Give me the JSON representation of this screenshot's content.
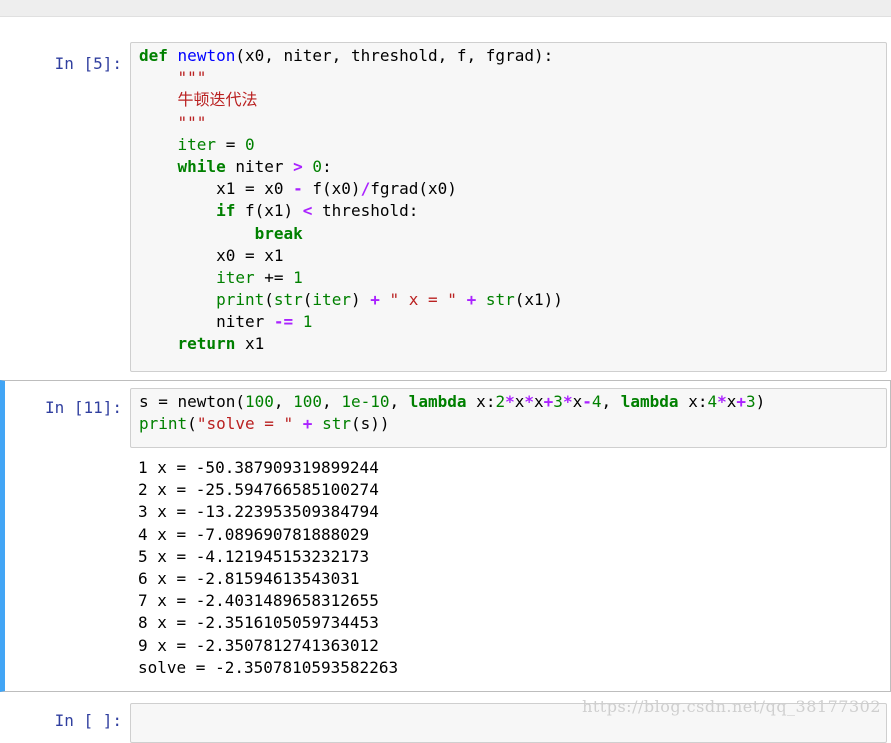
{
  "cells": [
    {
      "prompt": "In [5]:",
      "code_lines": [
        [
          {
            "t": "def",
            "c": "kw"
          },
          {
            "t": " "
          },
          {
            "t": "newton",
            "c": "fn"
          },
          {
            "t": "(x0, niter, threshold, f, fgrad):"
          }
        ],
        [
          {
            "t": "    "
          },
          {
            "t": "\"\"\"",
            "c": "str"
          }
        ],
        [
          {
            "t": "    "
          },
          {
            "t": "牛顿迭代法",
            "c": "str"
          }
        ],
        [
          {
            "t": "    "
          },
          {
            "t": "\"\"\"",
            "c": "str"
          }
        ],
        [
          {
            "t": "    "
          },
          {
            "t": "iter",
            "c": "bi"
          },
          {
            "t": " = "
          },
          {
            "t": "0",
            "c": "num"
          }
        ],
        [
          {
            "t": "    "
          },
          {
            "t": "while",
            "c": "kw"
          },
          {
            "t": " niter "
          },
          {
            "t": ">",
            "c": "op"
          },
          {
            "t": " "
          },
          {
            "t": "0",
            "c": "num"
          },
          {
            "t": ":"
          }
        ],
        [
          {
            "t": "        x1 = x0 "
          },
          {
            "t": "-",
            "c": "op"
          },
          {
            "t": " f(x0)"
          },
          {
            "t": "/",
            "c": "op"
          },
          {
            "t": "fgrad(x0)"
          }
        ],
        [
          {
            "t": "        "
          },
          {
            "t": "if",
            "c": "kw"
          },
          {
            "t": " f(x1) "
          },
          {
            "t": "<",
            "c": "op"
          },
          {
            "t": " threshold:"
          }
        ],
        [
          {
            "t": "            "
          },
          {
            "t": "break",
            "c": "kw"
          }
        ],
        [
          {
            "t": "        x0 = x1"
          }
        ],
        [
          {
            "t": "        "
          },
          {
            "t": "iter",
            "c": "bi"
          },
          {
            "t": " += "
          },
          {
            "t": "1",
            "c": "num"
          }
        ],
        [
          {
            "t": "        "
          },
          {
            "t": "print",
            "c": "bi"
          },
          {
            "t": "("
          },
          {
            "t": "str",
            "c": "bi"
          },
          {
            "t": "("
          },
          {
            "t": "iter",
            "c": "bi"
          },
          {
            "t": ") "
          },
          {
            "t": "+",
            "c": "op"
          },
          {
            "t": " "
          },
          {
            "t": "\" x = \"",
            "c": "str"
          },
          {
            "t": " "
          },
          {
            "t": "+",
            "c": "op"
          },
          {
            "t": " "
          },
          {
            "t": "str",
            "c": "bi"
          },
          {
            "t": "(x1))"
          }
        ],
        [
          {
            "t": "        niter "
          },
          {
            "t": "-=",
            "c": "op"
          },
          {
            "t": " "
          },
          {
            "t": "1",
            "c": "num"
          }
        ],
        [
          {
            "t": "    "
          },
          {
            "t": "return",
            "c": "kw"
          },
          {
            "t": " x1"
          }
        ]
      ]
    },
    {
      "prompt": "In [11]:",
      "code_lines": [
        [
          {
            "t": "s = newton("
          },
          {
            "t": "100",
            "c": "num"
          },
          {
            "t": ", "
          },
          {
            "t": "100",
            "c": "num"
          },
          {
            "t": ", "
          },
          {
            "t": "1e-10",
            "c": "num"
          },
          {
            "t": ", "
          },
          {
            "t": "lambda",
            "c": "kw"
          },
          {
            "t": " x:"
          },
          {
            "t": "2",
            "c": "num"
          },
          {
            "t": "*",
            "c": "op"
          },
          {
            "t": "x"
          },
          {
            "t": "*",
            "c": "op"
          },
          {
            "t": "x"
          },
          {
            "t": "+",
            "c": "op"
          },
          {
            "t": "3",
            "c": "num"
          },
          {
            "t": "*",
            "c": "op"
          },
          {
            "t": "x"
          },
          {
            "t": "-",
            "c": "op"
          },
          {
            "t": "4",
            "c": "num"
          },
          {
            "t": ", "
          },
          {
            "t": "lambda",
            "c": "kw"
          },
          {
            "t": " x:"
          },
          {
            "t": "4",
            "c": "num"
          },
          {
            "t": "*",
            "c": "op"
          },
          {
            "t": "x"
          },
          {
            "t": "+",
            "c": "op"
          },
          {
            "t": "3",
            "c": "num"
          },
          {
            "t": ")"
          }
        ],
        [
          {
            "t": "print",
            "c": "bi"
          },
          {
            "t": "("
          },
          {
            "t": "\"solve = \"",
            "c": "str"
          },
          {
            "t": " "
          },
          {
            "t": "+",
            "c": "op"
          },
          {
            "t": " "
          },
          {
            "t": "str",
            "c": "bi"
          },
          {
            "t": "(s))"
          }
        ]
      ],
      "output_lines": [
        "1 x = -50.387909319899244",
        "2 x = -25.594766585100274",
        "3 x = -13.223953509384794",
        "4 x = -7.089690781888029",
        "5 x = -4.121945153232173",
        "6 x = -2.81594613543031",
        "7 x = -2.4031489658312655",
        "8 x = -2.3516105059734453",
        "9 x = -2.3507812741363012",
        "solve = -2.3507810593582263"
      ]
    },
    {
      "prompt": "In [ ]:",
      "code_lines": []
    }
  ],
  "watermark": "https://blog.csdn.net/qq_38177302"
}
